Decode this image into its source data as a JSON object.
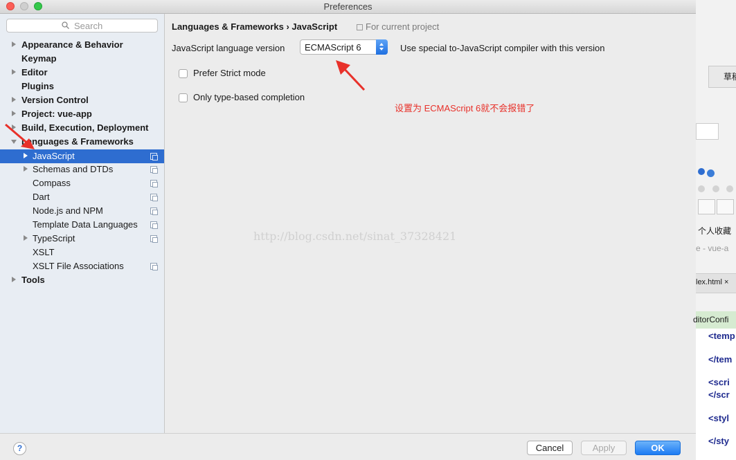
{
  "window": {
    "title": "Preferences"
  },
  "sidebar": {
    "search_placeholder": "Search",
    "items": [
      {
        "label": "Appearance & Behavior",
        "expandable": true
      },
      {
        "label": "Keymap"
      },
      {
        "label": "Editor",
        "expandable": true
      },
      {
        "label": "Plugins"
      },
      {
        "label": "Version Control",
        "expandable": true
      },
      {
        "label": "Project: vue-app",
        "expandable": true
      },
      {
        "label": "Build, Execution, Deployment",
        "expandable": true
      },
      {
        "label": "Languages & Frameworks",
        "expanded": true
      },
      {
        "label": "JavaScript",
        "selected": true
      },
      {
        "label": "Schemas and DTDs"
      },
      {
        "label": "Compass"
      },
      {
        "label": "Dart"
      },
      {
        "label": "Node.js and NPM"
      },
      {
        "label": "Template Data Languages"
      },
      {
        "label": "TypeScript"
      },
      {
        "label": "XSLT"
      },
      {
        "label": "XSLT File Associations"
      },
      {
        "label": "Tools",
        "expandable": true
      }
    ]
  },
  "content": {
    "breadcrumb": "Languages & Frameworks › JavaScript",
    "scope_note": "For current project",
    "version_label": "JavaScript language version",
    "version_value": "ECMAScript 6",
    "compiler_note": "Use special to-JavaScript compiler with this version",
    "prefer_strict": {
      "label": "Prefer Strict mode",
      "checked": false
    },
    "type_based": {
      "label": "Only type-based completion",
      "checked": false
    },
    "annotation": "设置为 ECMAScript 6就不会报错了",
    "watermark": "http://blog.csdn.net/sinat_37328421"
  },
  "footer": {
    "help": "?",
    "cancel": "Cancel",
    "apply": "Apply",
    "ok": "OK"
  },
  "background": {
    "tab": "草稿",
    "favorites": "个人收藏",
    "path": "e - vue-a",
    "file_tab": "lex.html ×",
    "editorconfig": "ditorConfi",
    "code_lines": [
      "<temp",
      "</tem",
      "<scri",
      "</scr",
      "<styl",
      "</sty"
    ]
  },
  "colors": {
    "selection": "#2e6dd0",
    "annotation": "#e8312a",
    "ok_button": "#1d7bf3"
  }
}
